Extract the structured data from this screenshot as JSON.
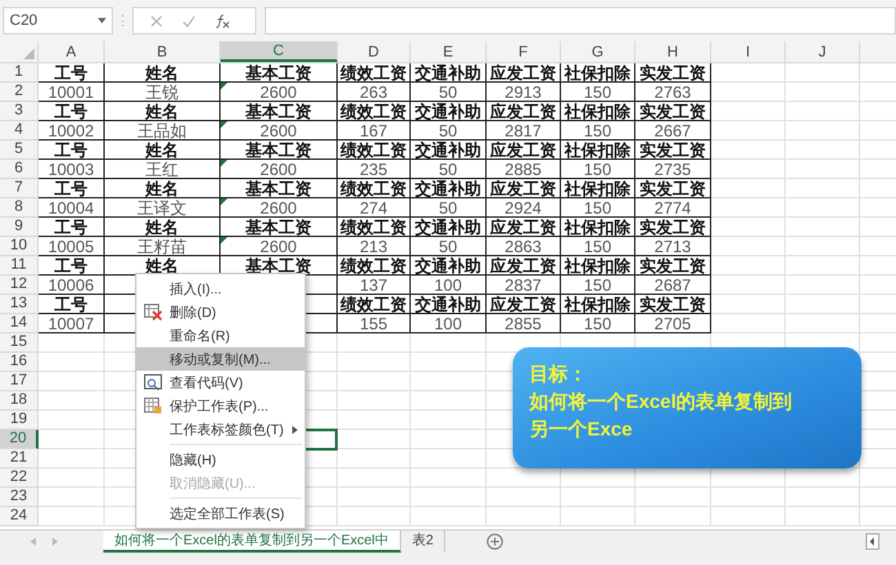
{
  "formula_bar": {
    "name_box": "C20"
  },
  "columns": [
    {
      "label": "A",
      "selected": false
    },
    {
      "label": "B",
      "selected": false
    },
    {
      "label": "C",
      "selected": true
    },
    {
      "label": "D",
      "selected": false
    },
    {
      "label": "E",
      "selected": false
    },
    {
      "label": "F",
      "selected": false
    },
    {
      "label": "G",
      "selected": false
    },
    {
      "label": "H",
      "selected": false
    },
    {
      "label": "I",
      "selected": false
    },
    {
      "label": "J",
      "selected": false
    }
  ],
  "rows": [
    {
      "number": "1",
      "kind": "header",
      "selected": false,
      "flagged": false,
      "cells": [
        "工号",
        "姓名",
        "基本工资",
        "绩效工资",
        "交通补助",
        "应发工资",
        "社保扣除",
        "实发工资"
      ]
    },
    {
      "number": "2",
      "kind": "data",
      "selected": false,
      "flagged": true,
      "cells": [
        "10001",
        "王锐",
        "2600",
        "263",
        "50",
        "2913",
        "150",
        "2763"
      ]
    },
    {
      "number": "3",
      "kind": "header",
      "selected": false,
      "flagged": false,
      "cells": [
        "工号",
        "姓名",
        "基本工资",
        "绩效工资",
        "交通补助",
        "应发工资",
        "社保扣除",
        "实发工资"
      ]
    },
    {
      "number": "4",
      "kind": "data",
      "selected": false,
      "flagged": true,
      "cells": [
        "10002",
        "王品如",
        "2600",
        "167",
        "50",
        "2817",
        "150",
        "2667"
      ]
    },
    {
      "number": "5",
      "kind": "header",
      "selected": false,
      "flagged": false,
      "cells": [
        "工号",
        "姓名",
        "基本工资",
        "绩效工资",
        "交通补助",
        "应发工资",
        "社保扣除",
        "实发工资"
      ]
    },
    {
      "number": "6",
      "kind": "data",
      "selected": false,
      "flagged": true,
      "cells": [
        "10003",
        "王红",
        "2600",
        "235",
        "50",
        "2885",
        "150",
        "2735"
      ]
    },
    {
      "number": "7",
      "kind": "header",
      "selected": false,
      "flagged": false,
      "cells": [
        "工号",
        "姓名",
        "基本工资",
        "绩效工资",
        "交通补助",
        "应发工资",
        "社保扣除",
        "实发工资"
      ]
    },
    {
      "number": "8",
      "kind": "data",
      "selected": false,
      "flagged": true,
      "cells": [
        "10004",
        "王译文",
        "2600",
        "274",
        "50",
        "2924",
        "150",
        "2774"
      ]
    },
    {
      "number": "9",
      "kind": "header",
      "selected": false,
      "flagged": false,
      "cells": [
        "工号",
        "姓名",
        "基本工资",
        "绩效工资",
        "交通补助",
        "应发工资",
        "社保扣除",
        "实发工资"
      ]
    },
    {
      "number": "10",
      "kind": "data",
      "selected": false,
      "flagged": true,
      "cells": [
        "10005",
        "王籽苗",
        "2600",
        "213",
        "50",
        "2863",
        "150",
        "2713"
      ]
    },
    {
      "number": "11",
      "kind": "header",
      "selected": false,
      "flagged": false,
      "cells": [
        "工号",
        "姓名",
        "基本工资",
        "绩效工资",
        "交通补助",
        "应发工资",
        "社保扣除",
        "实发工资"
      ]
    },
    {
      "number": "12",
      "kind": "data",
      "selected": false,
      "flagged": false,
      "cells": [
        "10006",
        null,
        null,
        "137",
        "100",
        "2837",
        "150",
        "2687"
      ]
    },
    {
      "number": "13",
      "kind": "header",
      "selected": false,
      "flagged": false,
      "cells": [
        "工号",
        null,
        null,
        "绩效工资",
        "交通补助",
        "应发工资",
        "社保扣除",
        "实发工资"
      ]
    },
    {
      "number": "14",
      "kind": "data",
      "selected": false,
      "flagged": false,
      "cells": [
        "10007",
        null,
        null,
        "155",
        "100",
        "2855",
        "150",
        "2705"
      ]
    },
    {
      "number": "15",
      "selected": false
    },
    {
      "number": "16",
      "selected": false
    },
    {
      "number": "17",
      "selected": false
    },
    {
      "number": "18",
      "selected": false
    },
    {
      "number": "19",
      "selected": false
    },
    {
      "number": "20",
      "selected": true
    },
    {
      "number": "21",
      "selected": false
    },
    {
      "number": "22",
      "selected": false
    },
    {
      "number": "23",
      "selected": false
    },
    {
      "number": "24",
      "selected": false
    }
  ],
  "context_menu": [
    {
      "kind": "item",
      "label": "插入(I)...",
      "highlighted": false,
      "disabled": false,
      "submenu": false
    },
    {
      "kind": "item",
      "label": "删除(D)",
      "highlighted": false,
      "disabled": false,
      "submenu": false
    },
    {
      "kind": "item",
      "label": "重命名(R)",
      "highlighted": false,
      "disabled": false,
      "submenu": false
    },
    {
      "kind": "item",
      "label": "移动或复制(M)...",
      "highlighted": true,
      "disabled": false,
      "submenu": false
    },
    {
      "kind": "item",
      "label": "查看代码(V)",
      "highlighted": false,
      "disabled": false,
      "submenu": false
    },
    {
      "kind": "item",
      "label": "保护工作表(P)...",
      "highlighted": false,
      "disabled": false,
      "submenu": false
    },
    {
      "kind": "item",
      "label": "工作表标签颜色(T)",
      "highlighted": false,
      "disabled": false,
      "submenu": true
    },
    {
      "kind": "separator"
    },
    {
      "kind": "item",
      "label": "隐藏(H)",
      "highlighted": false,
      "disabled": false,
      "submenu": false
    },
    {
      "kind": "item",
      "label": "取消隐藏(U)...",
      "highlighted": false,
      "disabled": true,
      "submenu": false
    },
    {
      "kind": "separator"
    },
    {
      "kind": "item",
      "label": "选定全部工作表(S)",
      "highlighted": false,
      "disabled": false,
      "submenu": false
    }
  ],
  "callout": {
    "title": "目标：",
    "lines": [
      "如何将一个Excel的表单复制到",
      "另一个Exce"
    ]
  },
  "sheet_tabs": [
    {
      "label": "如何将一个Excel的表单复制到另一个Excel中",
      "selected": true
    },
    {
      "label": "表2",
      "selected": false
    }
  ]
}
